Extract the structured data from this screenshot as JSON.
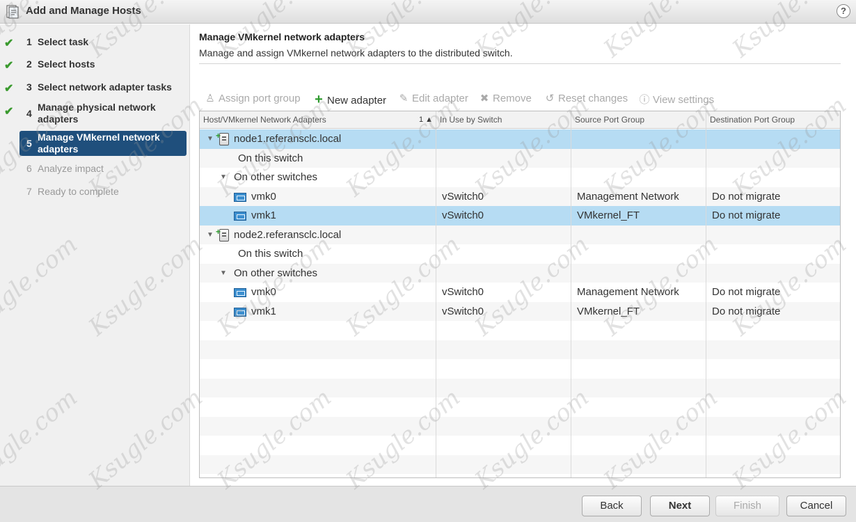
{
  "window": {
    "title": "Add and Manage Hosts",
    "help_label": "?"
  },
  "steps": [
    {
      "num": "1",
      "label": "Select task",
      "state": "done"
    },
    {
      "num": "2",
      "label": "Select hosts",
      "state": "done"
    },
    {
      "num": "3",
      "label": "Select network adapter tasks",
      "state": "done"
    },
    {
      "num": "4",
      "label": "Manage physical network adapters",
      "state": "done"
    },
    {
      "num": "5",
      "label": "Manage VMkernel network adapters",
      "state": "active"
    },
    {
      "num": "6",
      "label": "Analyze impact",
      "state": "disabled"
    },
    {
      "num": "7",
      "label": "Ready to complete",
      "state": "disabled"
    }
  ],
  "header": {
    "title": "Manage VMkernel network adapters",
    "subtitle": "Manage and assign VMkernel network adapters to the distributed switch."
  },
  "toolbar": {
    "assign_port_group": "Assign port group",
    "new_adapter": "New adapter",
    "edit_adapter": "Edit adapter",
    "remove": "Remove",
    "reset_changes": "Reset changes",
    "view_settings": "View settings"
  },
  "grid": {
    "columns": [
      "Host/VMkernel Network Adapters",
      "In Use by Switch",
      "Source Port Group",
      "Destination Port Group"
    ],
    "sort_indicator": "1 ▲",
    "rows": [
      {
        "type": "host",
        "name": "node1.referansclc.local",
        "switch": "",
        "source": "",
        "dest": ""
      },
      {
        "type": "group",
        "name": "On this switch",
        "switch": "",
        "source": "",
        "dest": ""
      },
      {
        "type": "group-expanded",
        "name": "On other switches",
        "switch": "",
        "source": "",
        "dest": ""
      },
      {
        "type": "vmk",
        "name": "vmk0",
        "switch": "vSwitch0",
        "source": "Management Network",
        "dest": "Do not migrate"
      },
      {
        "type": "vmk",
        "name": "vmk1",
        "switch": "vSwitch0",
        "source": "VMkernel_FT",
        "dest": "Do not migrate"
      },
      {
        "type": "host",
        "name": "node2.referansclc.local",
        "switch": "",
        "source": "",
        "dest": ""
      },
      {
        "type": "group",
        "name": "On this switch",
        "switch": "",
        "source": "",
        "dest": ""
      },
      {
        "type": "group-expanded",
        "name": "On other switches",
        "switch": "",
        "source": "",
        "dest": ""
      },
      {
        "type": "vmk",
        "name": "vmk0",
        "switch": "vSwitch0",
        "source": "Management Network",
        "dest": "Do not migrate"
      },
      {
        "type": "vmk",
        "name": "vmk1",
        "switch": "vSwitch0",
        "source": "VMkernel_FT",
        "dest": "Do not migrate"
      }
    ],
    "selected_rows": [
      0,
      4
    ]
  },
  "footer": {
    "back": "Back",
    "next": "Next",
    "finish": "Finish",
    "cancel": "Cancel"
  },
  "watermark": "Ksugle.com",
  "colors": {
    "active_step_bg": "#1f4f7c",
    "selected_row_bg": "#b6dcf3",
    "check_green": "#3a9a2e"
  }
}
